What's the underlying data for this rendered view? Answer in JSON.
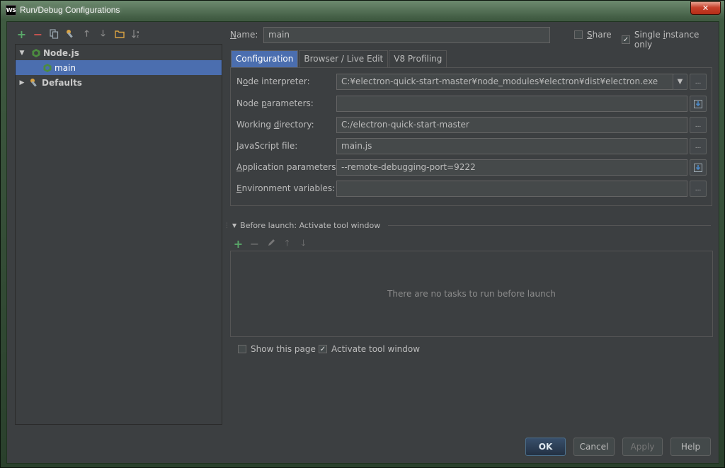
{
  "window": {
    "title": "Run/Debug Configurations",
    "logo": "WS",
    "close_glyph": "✕"
  },
  "toolbar_icons": [
    "add-icon",
    "remove-icon",
    "copy-icon",
    "wrench-icon",
    "move-up-icon",
    "move-down-icon",
    "folder-icon",
    "sort-icon"
  ],
  "tree": {
    "items": [
      {
        "label": "Node.js",
        "expanded": true
      },
      {
        "label": "main",
        "selected": true
      },
      {
        "label": "Defaults",
        "expanded": false
      }
    ]
  },
  "name_field": {
    "label": "Name:",
    "value": "main"
  },
  "share": {
    "label": "Share",
    "checked": false
  },
  "single_instance": {
    "label": "Single instance only",
    "checked": true
  },
  "tabs": [
    {
      "label": "Configuration",
      "active": true
    },
    {
      "label": "Browser / Live Edit",
      "active": false
    },
    {
      "label": "V8 Profiling",
      "active": false
    }
  ],
  "config": {
    "node_interpreter": {
      "label": "Node interpreter:",
      "value": "C:¥electron-quick-start-master¥node_modules¥electron¥dist¥electron.exe"
    },
    "node_parameters": {
      "label": "Node parameters:",
      "value": ""
    },
    "working_directory": {
      "label": "Working directory:",
      "value": "C:/electron-quick-start-master"
    },
    "javascript_file": {
      "label": "JavaScript file:",
      "value": "main.js"
    },
    "app_parameters": {
      "label": "Application parameters:",
      "value": "--remote-debugging-port=9222"
    },
    "env_variables": {
      "label": "Environment variables:",
      "value": ""
    },
    "browse_glyph": "..."
  },
  "before_launch": {
    "title": "Before launch: Activate tool window",
    "empty_text": "There are no tasks to run before launch",
    "icons": [
      "add-icon",
      "remove-icon",
      "edit-icon",
      "move-up-icon",
      "move-down-icon"
    ]
  },
  "show_page": {
    "label": "Show this page",
    "checked": false
  },
  "activate_tool": {
    "label": "Activate tool window",
    "checked": true
  },
  "buttons": {
    "ok": "OK",
    "cancel": "Cancel",
    "apply": "Apply",
    "help": "Help"
  },
  "colors": {
    "accent": "#4b6eaf",
    "background": "#3c3f41",
    "add_green": "#59a869",
    "remove_red": "#c75450"
  }
}
